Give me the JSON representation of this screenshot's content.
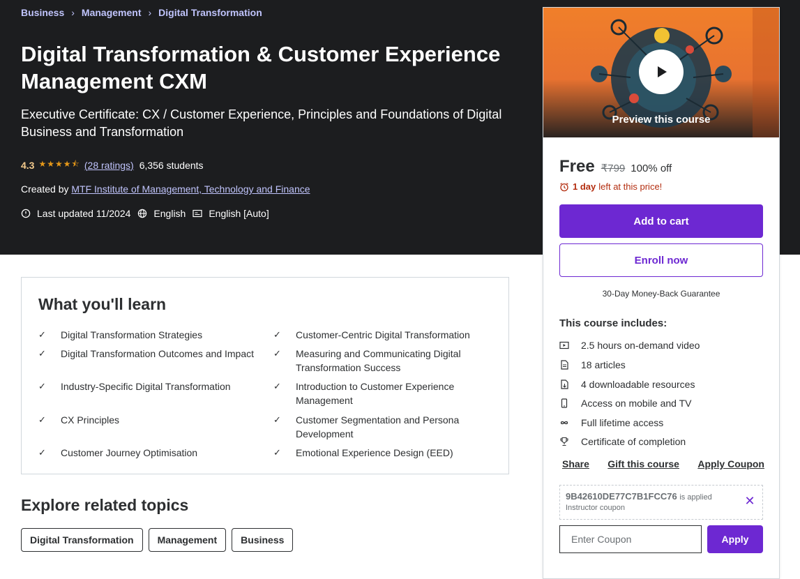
{
  "breadcrumb": [
    "Business",
    "Management",
    "Digital Transformation"
  ],
  "course": {
    "title": "Digital Transformation & Customer Experience Management CXM",
    "subtitle": "Executive Certificate: CX / Customer Experience, Principles and Foundations of Digital Business and Transformation",
    "rating": "4.3",
    "stars": 4.3,
    "ratings_count": "(28 ratings)",
    "students": "6,356 students",
    "created_by_label": "Created by",
    "instructor": "MTF Institute of Management, Technology and Finance",
    "last_updated": "Last updated 11/2024",
    "language": "English",
    "captions": "English [Auto]"
  },
  "learn": {
    "title": "What you'll learn",
    "items": [
      "Digital Transformation Strategies",
      "Customer-Centric Digital Transformation",
      "Digital Transformation Outcomes and Impact",
      "Measuring and Communicating Digital Transformation Success",
      "Industry-Specific Digital Transformation",
      "Introduction to Customer Experience Management",
      "CX Principles",
      "Customer Segmentation and Persona Development",
      "Customer Journey Optimisation",
      "Emotional Experience Design (EED)"
    ]
  },
  "related": {
    "title": "Explore related topics",
    "topics": [
      "Digital Transformation",
      "Management",
      "Business"
    ]
  },
  "sidebar": {
    "preview_label": "Preview this course",
    "price": "Free",
    "original_price": "₹799",
    "discount": "100% off",
    "timer_bold": "1 day",
    "timer_rest": "left at this price!",
    "add_to_cart": "Add to cart",
    "enroll_now": "Enroll now",
    "guarantee": "30-Day Money-Back Guarantee",
    "includes_title": "This course includes:",
    "includes": [
      "2.5 hours on-demand video",
      "18 articles",
      "4 downloadable resources",
      "Access on mobile and TV",
      "Full lifetime access",
      "Certificate of completion"
    ],
    "links": [
      "Share",
      "Gift this course",
      "Apply Coupon"
    ],
    "coupon_code": "9B42610DE77C7B1FCC76",
    "coupon_applied_text": "is applied",
    "coupon_type": "Instructor coupon",
    "coupon_placeholder": "Enter Coupon",
    "apply_label": "Apply"
  },
  "colors": {
    "hero_bg": "#1c1d1f",
    "accent": "#6d28d2",
    "link_light": "#c0c4fc",
    "star": "#e59819",
    "alert": "#b32d0f"
  }
}
